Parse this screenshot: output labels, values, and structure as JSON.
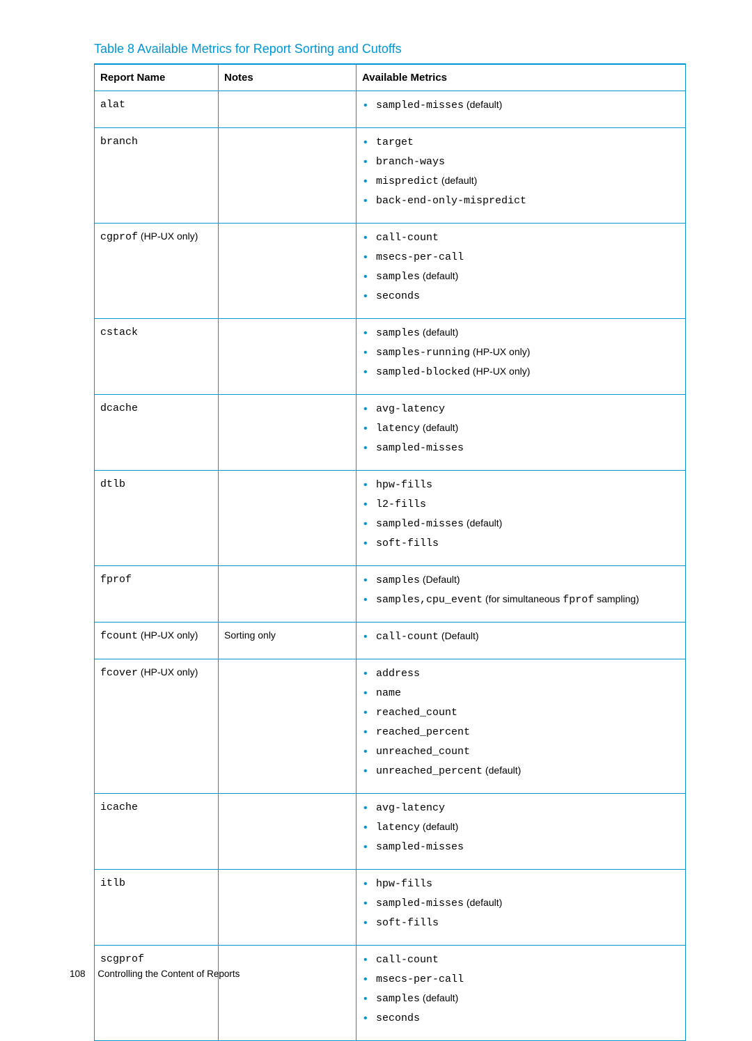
{
  "table_title": "Table 8 Available Metrics for Report Sorting and Cutoffs",
  "headers": {
    "col1": "Report Name",
    "col2": "Notes",
    "col3": "Available Metrics"
  },
  "rows": [
    {
      "name_code": "alat",
      "name_suffix": "",
      "notes": "",
      "metrics": [
        {
          "code": "sampled-misses",
          "suffix": " (default)"
        }
      ]
    },
    {
      "name_code": "branch",
      "name_suffix": "",
      "notes": "",
      "metrics": [
        {
          "code": "target",
          "suffix": ""
        },
        {
          "code": "branch-ways",
          "suffix": ""
        },
        {
          "code": "mispredict",
          "suffix": " (default)"
        },
        {
          "code": "back-end-only-mispredict",
          "suffix": ""
        }
      ]
    },
    {
      "name_code": "cgprof",
      "name_suffix": " (HP-UX only)",
      "notes": "",
      "metrics": [
        {
          "code": "call-count",
          "suffix": ""
        },
        {
          "code": "msecs-per-call",
          "suffix": ""
        },
        {
          "code": "samples",
          "suffix": " (default)"
        },
        {
          "code": "seconds",
          "suffix": ""
        }
      ]
    },
    {
      "name_code": "cstack",
      "name_suffix": "",
      "notes": "",
      "metrics": [
        {
          "code": "samples",
          "suffix": " (default)"
        },
        {
          "code": "samples-running",
          "suffix": " (HP-UX only)"
        },
        {
          "code": "sampled-blocked",
          "suffix": " (HP-UX only)"
        }
      ]
    },
    {
      "name_code": "dcache",
      "name_suffix": "",
      "notes": "",
      "metrics": [
        {
          "code": "avg-latency",
          "suffix": ""
        },
        {
          "code": "latency",
          "suffix": " (default)"
        },
        {
          "code": "sampled-misses",
          "suffix": ""
        }
      ]
    },
    {
      "name_code": "dtlb",
      "name_suffix": "",
      "notes": "",
      "metrics": [
        {
          "code": "hpw-fills",
          "suffix": ""
        },
        {
          "code": "l2-fills",
          "suffix": ""
        },
        {
          "code": "sampled-misses",
          "suffix": " (default)"
        },
        {
          "code": "soft-fills",
          "suffix": ""
        }
      ]
    },
    {
      "name_code": "fprof",
      "name_suffix": "",
      "notes": "",
      "metrics": [
        {
          "code": "samples",
          "suffix": " (Default)"
        },
        {
          "code": "samples,cpu_event",
          "suffix": " (for simultaneous ",
          "code2": "fprof",
          "suffix2": " sampling)"
        }
      ]
    },
    {
      "name_code": "fcount",
      "name_suffix": " (HP-UX only)",
      "notes": "Sorting only",
      "metrics": [
        {
          "code": "call-count",
          "suffix": " (Default)"
        }
      ]
    },
    {
      "name_code": "fcover",
      "name_suffix": " (HP-UX only)",
      "notes": "",
      "metrics": [
        {
          "code": "address",
          "suffix": ""
        },
        {
          "code": "name",
          "suffix": ""
        },
        {
          "code": "reached_count",
          "suffix": ""
        },
        {
          "code": "reached_percent",
          "suffix": ""
        },
        {
          "code": "unreached_count",
          "suffix": ""
        },
        {
          "code": "unreached_percent",
          "suffix": " (default)"
        }
      ]
    },
    {
      "name_code": "icache",
      "name_suffix": "",
      "notes": "",
      "metrics": [
        {
          "code": "avg-latency",
          "suffix": ""
        },
        {
          "code": "latency",
          "suffix": " (default)"
        },
        {
          "code": "sampled-misses",
          "suffix": ""
        }
      ]
    },
    {
      "name_code": "itlb",
      "name_suffix": "",
      "notes": "",
      "metrics": [
        {
          "code": "hpw-fills",
          "suffix": ""
        },
        {
          "code": "sampled-misses",
          "suffix": " (default)"
        },
        {
          "code": "soft-fills",
          "suffix": ""
        }
      ]
    },
    {
      "name_code": "scgprof",
      "name_suffix": "",
      "notes": "",
      "metrics": [
        {
          "code": "call-count",
          "suffix": ""
        },
        {
          "code": "msecs-per-call",
          "suffix": ""
        },
        {
          "code": "samples",
          "suffix": " (default)"
        },
        {
          "code": "seconds",
          "suffix": ""
        }
      ]
    }
  ],
  "footer": {
    "page": "108",
    "section": "Controlling the Content of Reports"
  }
}
